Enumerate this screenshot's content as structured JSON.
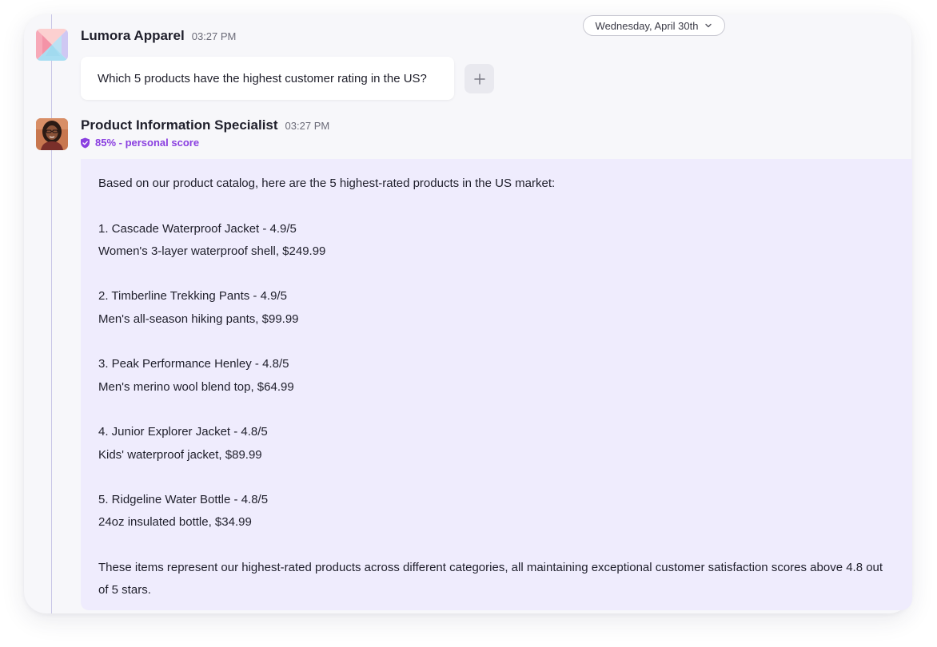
{
  "date_selector": {
    "label": "Wednesday, April 30th"
  },
  "messages": [
    {
      "sender": "Lumora Apparel",
      "time": "03:27 PM",
      "text": "Which 5 products have the highest customer rating in the US?"
    },
    {
      "sender": "Product Information Specialist",
      "time": "03:27 PM",
      "score": "85% - personal score",
      "intro": "Based on our product catalog, here are the 5 highest-rated products in the US market:",
      "items": [
        {
          "title": "1. Cascade Waterproof Jacket - 4.9/5",
          "detail": "Women's 3-layer waterproof shell, $249.99"
        },
        {
          "title": "2. Timberline Trekking Pants - 4.9/5",
          "detail": "Men's all-season hiking pants, $99.99"
        },
        {
          "title": "3. Peak Performance Henley - 4.8/5",
          "detail": "Men's merino wool blend top, $64.99"
        },
        {
          "title": "4. Junior Explorer Jacket - 4.8/5",
          "detail": "Kids' waterproof jacket, $89.99"
        },
        {
          "title": "5. Ridgeline Water Bottle - 4.8/5",
          "detail": "24oz insulated bottle, $34.99"
        }
      ],
      "outro": "These items represent our highest-rated products across different categories, all maintaining exceptional customer satisfaction scores above 4.8 out of 5 stars."
    }
  ],
  "icons": {
    "date_chevron": "chevron-down-icon",
    "add": "plus-icon",
    "score": "verified-shield-icon"
  },
  "colors": {
    "accent": "#8a3fe0",
    "reply_bubble": "#efecfd",
    "panel": "#f7f7fa"
  }
}
